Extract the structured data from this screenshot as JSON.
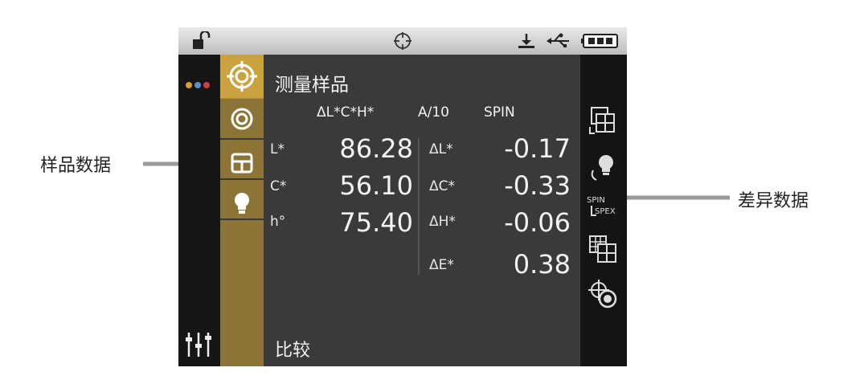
{
  "annotations": {
    "sample_data": "样品数据",
    "difference_data": "差异数据"
  },
  "screen": {
    "title": "测量样品",
    "header": {
      "mode": "ΔL*C*H*",
      "illuminant": "A/10",
      "spin": "SPIN"
    },
    "sample": [
      {
        "label": "L*",
        "value": "86.28"
      },
      {
        "label": "C*",
        "value": "56.10"
      },
      {
        "label": "h°",
        "value": "75.40"
      }
    ],
    "difference": [
      {
        "label": "ΔL*",
        "value": "-0.17"
      },
      {
        "label": "ΔC*",
        "value": "-0.33"
      },
      {
        "label": "ΔH*",
        "value": "-0.06"
      },
      {
        "label": "ΔE*",
        "value": "0.38"
      }
    ],
    "bottom_label": "比较",
    "spin_spex_icon_text": {
      "top": "SPIN",
      "bottom": "SPEX"
    }
  },
  "icons": {
    "status": [
      "lock-open-icon",
      "target-icon",
      "download-icon",
      "usb-icon",
      "battery-icon"
    ],
    "tabs": [
      "measure-target-icon",
      "concentric-circle-icon",
      "window-grid-icon",
      "lightbulb-icon"
    ],
    "right": [
      "grid-view-icon",
      "lightbulb-switch-icon",
      "spin-spex-icon",
      "multi-grid-icon",
      "target-compare-icon"
    ],
    "left": [
      "menu-dots-icon",
      "sliders-icon"
    ]
  },
  "colors": {
    "screen_bg": "#3a3a3a",
    "tab_active": "#caa23f",
    "tab_column": "#8c7436",
    "status_bar": "#d4d4d4"
  }
}
